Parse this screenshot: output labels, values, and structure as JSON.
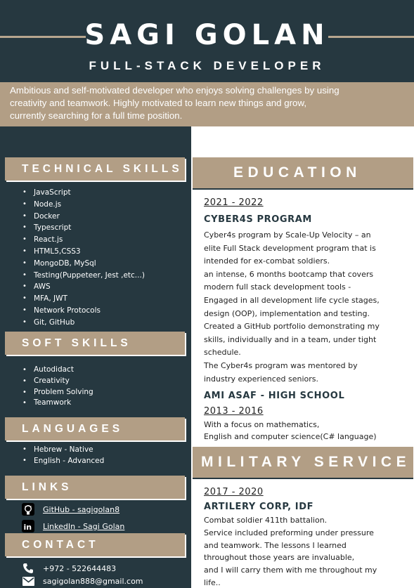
{
  "header": {
    "name": "SAGI GOLAN",
    "title": "FULL-STACK DEVELOPER"
  },
  "summary": {
    "lines": [
      "Ambitious and self-motivated developer who enjoys solving challenges by using",
      "creativity and teamwork. Highly motivated to learn new things and grow,",
      "currently searching for a full time position."
    ]
  },
  "sidebar": {
    "technical": {
      "heading": "TECHNICAL SKILLS",
      "items": [
        "JavaScript",
        "Node.js",
        "Docker",
        "Typescript",
        "React.js",
        "HTML5,CSS3",
        "MongoDB, MySql",
        "Testing(Puppeteer, Jest ,etc...)",
        "AWS",
        "MFA, JWT",
        "Network Protocols",
        "Git, GitHub"
      ]
    },
    "soft": {
      "heading": "SOFT SKILLS",
      "items": [
        "Autodidact",
        "Creativity",
        "Problem Solving",
        "Teamwork"
      ]
    },
    "languages": {
      "heading": "LANGUAGES",
      "items": [
        "Hebrew - Native",
        "English - Advanced"
      ]
    },
    "links": {
      "heading": "LINKS",
      "github": {
        "label": "GitHub - sagigolan8",
        "icon": "github-icon"
      },
      "linkedin": {
        "label": "LinkedIn - Sagi Golan",
        "icon": "linkedin-icon"
      }
    },
    "contact": {
      "heading": "CONTACT",
      "phone": {
        "label": "+972 - 522644483",
        "icon": "phone-icon"
      },
      "email": {
        "label": "sagigolan888@gmail.com",
        "icon": "mail-icon"
      }
    }
  },
  "education": {
    "heading": "EDUCATION",
    "entry1": {
      "date": "2021 - 2022",
      "org": "CYBER4S PROGRAM",
      "lines": [
        "Cyber4s program by Scale-Up Velocity – an",
        "elite Full Stack development program that is",
        "intended for ex-combat soldiers.",
        "an intense, 6 months bootcamp that covers",
        "modern full stack development tools -",
        "Engaged in all development life cycle stages,",
        "design (OOP), implementation and testing.",
        "Created a GitHub portfolio demonstrating my",
        "skills, individually and in a team, under tight",
        "schedule.",
        "The Cyber4s program was mentored by",
        "industry experienced seniors."
      ]
    },
    "entry2": {
      "org": "AMI ASAF - HIGH SCHOOL",
      "date": "2013 - 2016",
      "lines": [
        "With a focus on mathematics,",
        "English and computer science(C# language)"
      ]
    }
  },
  "military": {
    "heading": "MILITARY SERVICE",
    "date": "2017 - 2020",
    "org": "ARTILERY CORP, IDF",
    "lines": [
      "Combat soldier 411th battalion.",
      "Service included preforming under pressure",
      "and teamwork. The lessons I learned",
      "throughout those years are invaluable,",
      "and I will carry them with me throughout my",
      "life.."
    ]
  },
  "colors": {
    "dark": "#263840",
    "accent": "#b29e85",
    "text": "#222222"
  }
}
